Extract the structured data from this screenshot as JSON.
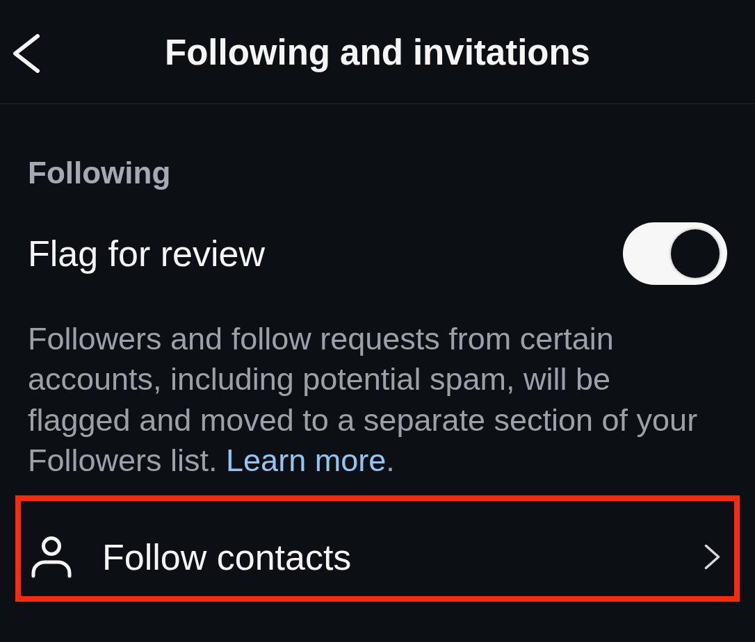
{
  "header": {
    "title": "Following and invitations"
  },
  "sections": [
    {
      "heading": "Following",
      "items": [
        {
          "kind": "toggle",
          "label": "Flag for review",
          "on": true,
          "description": {
            "text": "Followers and follow requests from certain accounts, including potential spam, will be flagged and moved to a separate section of your Followers list.",
            "link": "Learn more",
            "end": "."
          }
        },
        {
          "kind": "link",
          "label": "Follow contacts",
          "highlighted": true
        }
      ]
    }
  ]
}
